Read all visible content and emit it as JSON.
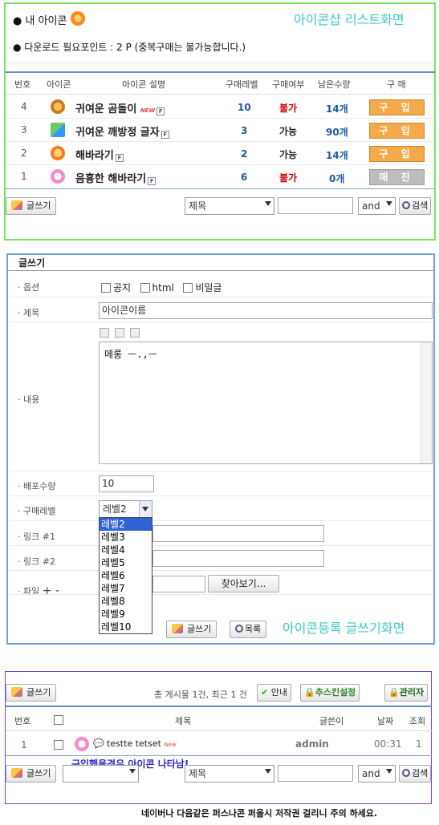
{
  "shop": {
    "heading": "내 아이콘",
    "points_line": "다운로드 필요포인트 : 2 P (중복구매는 불가능합니다.)",
    "annotation": "아이콘샵 리스트화면",
    "columns": [
      "번호",
      "아이콘",
      "아이콘 설명",
      "구매레벨",
      "구매여부",
      "남은수량",
      "구 매"
    ],
    "rows": [
      {
        "num": "4",
        "name": "귀여운 곰돌이",
        "new": "NEW",
        "level": "10",
        "status": "불가",
        "qty": "14개",
        "action": "구 입"
      },
      {
        "num": "3",
        "name": "귀여운 깨방정 글자",
        "new": "",
        "level": "3",
        "status": "가능",
        "qty": "90개",
        "action": "구 입"
      },
      {
        "num": "2",
        "name": "해바라기",
        "new": "",
        "level": "2",
        "status": "가능",
        "qty": "14개",
        "action": "구 입"
      },
      {
        "num": "1",
        "name": "음흉한 해바라기",
        "new": "",
        "level": "6",
        "status": "불가",
        "qty": "0개",
        "action": "매 진"
      }
    ],
    "write_button": "글쓰기",
    "search_field": "제목",
    "search_op": "and",
    "search_button": "검색"
  },
  "form": {
    "title": "글쓰기",
    "labels": {
      "options": "옵션",
      "subject": "제목",
      "content": "내용",
      "count": "배포수량",
      "level": "구매레벨",
      "link1": "링크 #1",
      "link2": "링크 #2",
      "file": "파일"
    },
    "options": [
      "공지",
      "html",
      "비밀글"
    ],
    "subject_value": "아이콘이름",
    "content_value": "메롱 ㅡ.,ㅡ",
    "count_value": "10",
    "level_value": "레벨2",
    "level_options": [
      "레벨2",
      "레벨3",
      "레벨4",
      "레벨5",
      "레벨6",
      "레벨7",
      "레벨8",
      "레벨9",
      "레벨10"
    ],
    "file_plus_minus": "+ -",
    "browse_button": "찾아보기...",
    "write_button": "글쓰기",
    "list_button": "목록",
    "annotation": "아이콘등록 글쓰기화면"
  },
  "board": {
    "write_button": "글쓰기",
    "summary": "총 게시물 1건, 최근 1 건",
    "guide_button": "안내",
    "skin_button": "추스킨설정",
    "admin_button": "관리자",
    "columns": [
      "번호",
      "제목",
      "글쓴이",
      "날짜",
      "조회"
    ],
    "rows": [
      {
        "num": "1",
        "title": "testte tetset",
        "new": "New",
        "author": "admin",
        "date": "00:31",
        "views": "1"
      }
    ],
    "annotation": "구입했을경우 아이콘 나타남!",
    "write_button2": "글쓰기",
    "search_field": "제목",
    "search_op": "and",
    "search_button": "검색"
  },
  "footer_note": "네이버나 다음같은 퍼스나콘 퍼올시 저작권 걸리니 주의 하세요."
}
